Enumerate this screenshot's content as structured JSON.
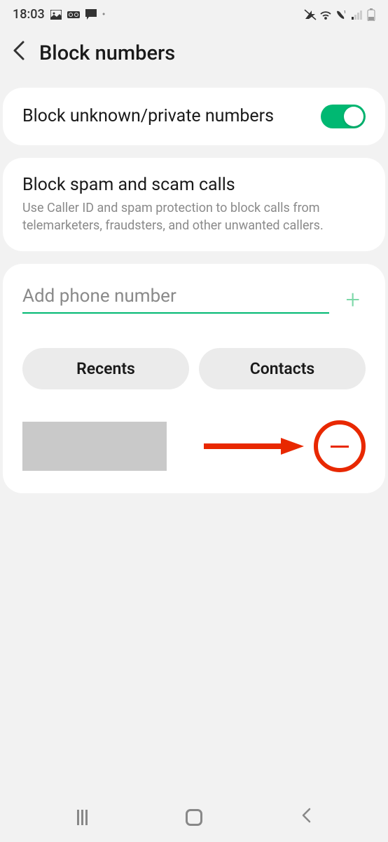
{
  "statusBar": {
    "time": "18:03",
    "dot": "•"
  },
  "header": {
    "title": "Block numbers"
  },
  "blockUnknown": {
    "label": "Block unknown/private numbers",
    "enabled": true
  },
  "blockSpam": {
    "title": "Block spam and scam calls",
    "description": "Use Caller ID and spam protection to block calls from telemarketers, fraudsters, and other unwanted callers."
  },
  "addNumber": {
    "placeholder": "Add phone number"
  },
  "buttons": {
    "recents": "Recents",
    "contacts": "Contacts"
  },
  "annotation": {
    "arrowColor": "#e82800"
  }
}
